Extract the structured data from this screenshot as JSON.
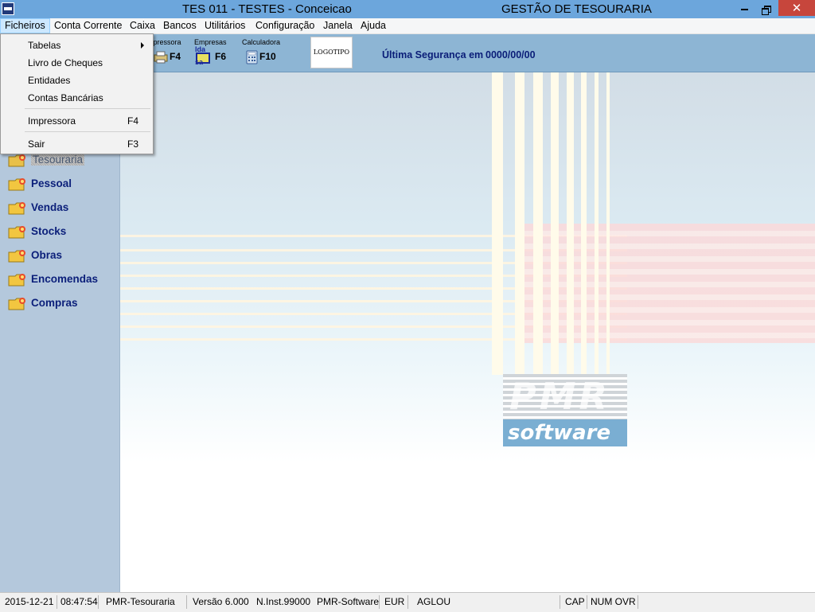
{
  "window": {
    "title": "TES 011 - TESTES - Conceicao",
    "app_title": "GESTÃO DE TESOURARIA",
    "close_glyph": "✕"
  },
  "menubar": {
    "items": [
      {
        "label": "Ficheiros"
      },
      {
        "label": "Conta Corrente"
      },
      {
        "label": "Caixa"
      },
      {
        "label": "Bancos"
      },
      {
        "label": "Utilitários"
      },
      {
        "label": "Configuração"
      },
      {
        "label": "Janela"
      },
      {
        "label": "Ajuda"
      }
    ]
  },
  "dropdown": {
    "items": [
      {
        "label": "Tabelas",
        "submenu": true
      },
      {
        "label": "Livro de Cheques"
      },
      {
        "label": "Entidades"
      },
      {
        "label": "Contas Bancárias"
      },
      {
        "label": "Impressora",
        "shortcut": "F4"
      },
      {
        "label": "Sair",
        "shortcut": "F3"
      }
    ]
  },
  "toolbar": {
    "buttons": [
      {
        "caption": "mpressora",
        "key": "F4",
        "icon": "printer-icon"
      },
      {
        "caption": "Empresas",
        "key": "F6",
        "icon": "companies-icon",
        "icon_text_top": "lda",
        "icon_text_bottom": "sa"
      },
      {
        "caption": "Calculadora",
        "key": "F10",
        "icon": "calculator-icon"
      }
    ],
    "logo_label": "LOGOTIPO",
    "security_label": "Última Segurança em",
    "security_value": "0000/00/00"
  },
  "sidebar": {
    "items": [
      {
        "label": "Tesouraria",
        "selected": true
      },
      {
        "label": "Pessoal"
      },
      {
        "label": "Vendas"
      },
      {
        "label": "Stocks"
      },
      {
        "label": "Obras"
      },
      {
        "label": "Encomendas"
      },
      {
        "label": "Compras"
      }
    ]
  },
  "brand": {
    "logo_top": "PMR",
    "logo_bottom": "software"
  },
  "statusbar": {
    "date": "2015-12-21",
    "time": "08:47:54",
    "module": "PMR-Tesouraria",
    "version": "Versão  6.000",
    "ninst": "N.Inst.99000",
    "company": "PMR-Software",
    "currency": "EUR",
    "user": "AGLOU",
    "cap": "CAP",
    "num_ovr": "NUM OVR"
  },
  "colors": {
    "titlebar": "#6ca6dc",
    "toolbar": "#8db5d4",
    "sidebar": "#b4c8dc",
    "sidebar_text": "#0b1f7a",
    "close_button": "#c7463c",
    "brand_blue": "#7aaed2"
  }
}
